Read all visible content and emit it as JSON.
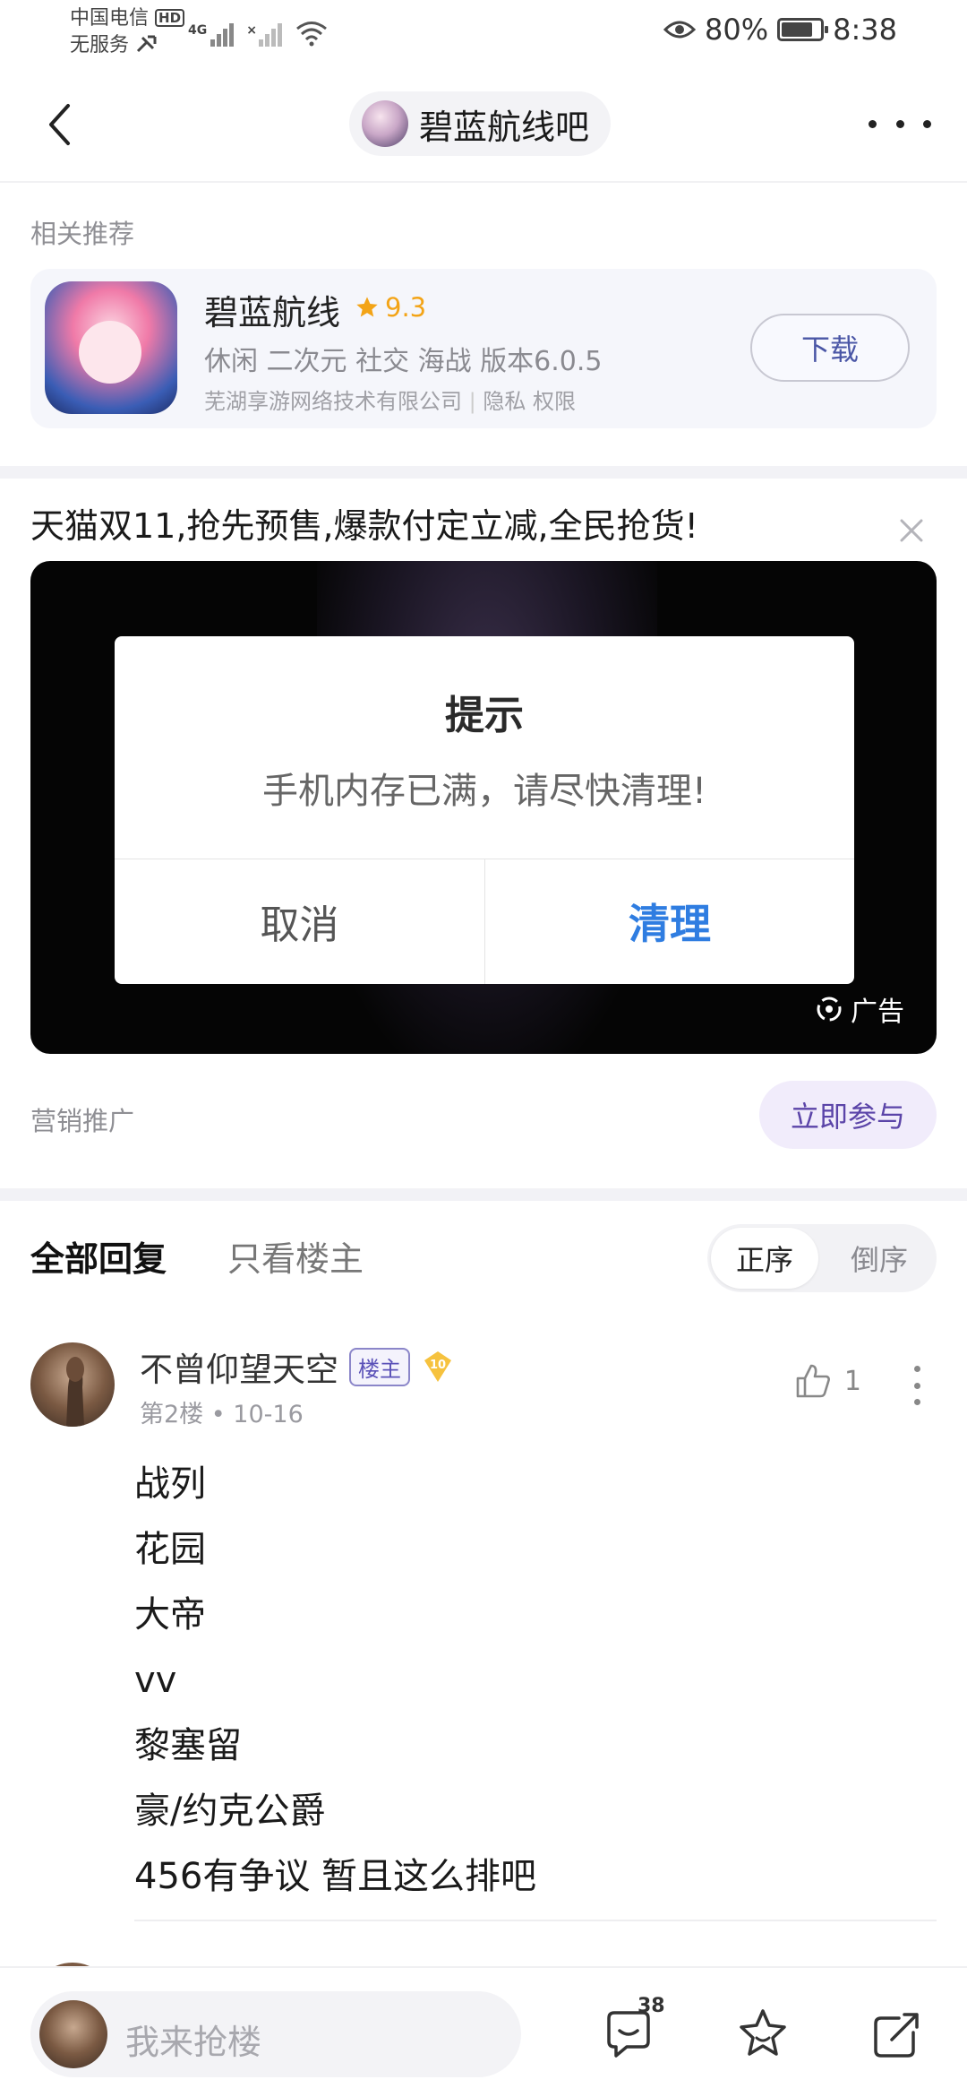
{
  "status_bar": {
    "carrier_line1": "中国电信",
    "hd": "HD",
    "carrier_line2": "无服务",
    "network": "4G",
    "battery": "80%",
    "battery_level": 0.8,
    "time": "8:38"
  },
  "header": {
    "forum_name": "碧蓝航线吧"
  },
  "related": {
    "title": "相关推荐",
    "app_name": "碧蓝航线",
    "rating": "9.3",
    "tags": "休闲 二次元 社交 海战   版本6.0.5",
    "developer": "芜湖享游网络技术有限公司",
    "privacy": "隐私",
    "permissions": "权限",
    "download_label": "下载"
  },
  "ad": {
    "title": "天猫双11,抢先预售,爆款付定立减,全民抢货!",
    "dialog_title": "提示",
    "dialog_message": "手机内存已满，请尽快清理!",
    "dialog_cancel": "取消",
    "dialog_clean": "清理",
    "badge": "广告",
    "promo_label": "营销推广",
    "join_label": "立即参与"
  },
  "tabs": {
    "all_replies": "全部回复",
    "owner_only": "只看楼主",
    "sort_asc": "正序",
    "sort_desc": "倒序"
  },
  "post": {
    "author": "不曾仰望天空",
    "owner_badge": "楼主",
    "level": "10",
    "floor": "第2楼",
    "date": "10-16",
    "likes": "1",
    "lines": [
      "战列",
      "花园",
      "大帝",
      "vv",
      "黎塞留",
      "豪/约克公爵",
      "456有争议 暂且这么排吧"
    ]
  },
  "bottom_bar": {
    "reply_placeholder": "我来抢楼",
    "comment_count": "38"
  }
}
